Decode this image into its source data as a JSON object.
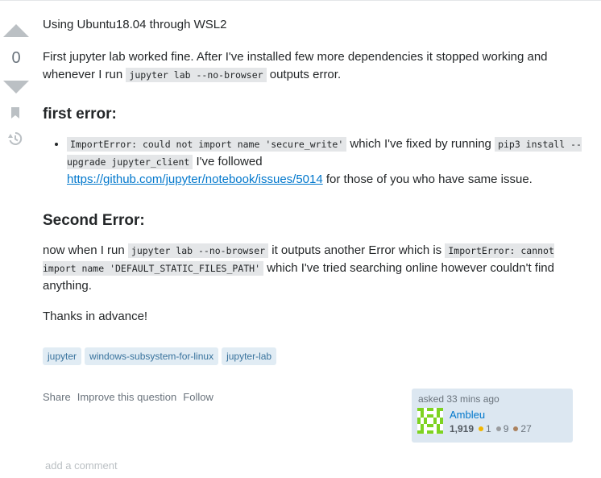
{
  "question": {
    "vote_count": "0",
    "title_line": "Using Ubuntu18.04 through WSL2",
    "p1": {
      "text_a": "First jupyter lab worked fine. After I've installed few more dependencies it stopped working and whenever I run ",
      "code_a": "jupyter lab --no-browser",
      "text_b": " outputs error."
    },
    "heading_1": "first error:",
    "bullet": {
      "code_a": "ImportError: could not import name 'secure_write'",
      "text_a": " which I've fixed by running ",
      "code_b": "pip3 install --upgrade jupyter_client",
      "text_b": " I've followed ",
      "link_text": "https://github.com/jupyter/notebook/issues/5014",
      "text_c": " for those of you who have same issue."
    },
    "heading_2": "Second Error:",
    "p2": {
      "text_a": "now when I run ",
      "code_a": "jupyter lab --no-browser",
      "text_b": " it outputs another Error which is ",
      "code_b": "ImportError: cannot import name 'DEFAULT_STATIC_FILES_PATH'",
      "text_c": " which I've tried searching online however couldn't find anything."
    },
    "p3": "Thanks in advance!",
    "tags": [
      "jupyter",
      "windows-subsystem-for-linux",
      "jupyter-lab"
    ]
  },
  "post_menu": {
    "share": "Share",
    "improve": "Improve this question",
    "follow": "Follow"
  },
  "user_card": {
    "asked": "asked 33 mins ago",
    "name": "Ambleu",
    "reputation": "1,919",
    "gold": "1",
    "silver": "9",
    "bronze": "27",
    "gold_color": "#f1b600",
    "silver_color": "#9a9c9f",
    "bronze_color": "#ab825f"
  },
  "comments": {
    "add_label": "add a comment"
  },
  "colors": {
    "vote_arrow": "#bbc0c4",
    "link": "#0077cc",
    "tag_bg": "#e1ecf4",
    "tag_text": "#39739d",
    "avatar_green": "#7ed321"
  }
}
